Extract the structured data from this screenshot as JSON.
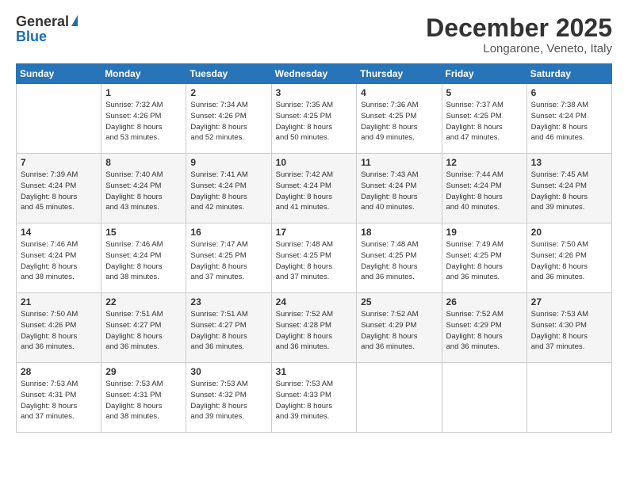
{
  "logo": {
    "general": "General",
    "blue": "Blue"
  },
  "title": {
    "month": "December 2025",
    "location": "Longarone, Veneto, Italy"
  },
  "headers": [
    "Sunday",
    "Monday",
    "Tuesday",
    "Wednesday",
    "Thursday",
    "Friday",
    "Saturday"
  ],
  "weeks": [
    [
      {
        "day": "",
        "info": ""
      },
      {
        "day": "1",
        "info": "Sunrise: 7:32 AM\nSunset: 4:26 PM\nDaylight: 8 hours\nand 53 minutes."
      },
      {
        "day": "2",
        "info": "Sunrise: 7:34 AM\nSunset: 4:26 PM\nDaylight: 8 hours\nand 52 minutes."
      },
      {
        "day": "3",
        "info": "Sunrise: 7:35 AM\nSunset: 4:25 PM\nDaylight: 8 hours\nand 50 minutes."
      },
      {
        "day": "4",
        "info": "Sunrise: 7:36 AM\nSunset: 4:25 PM\nDaylight: 8 hours\nand 49 minutes."
      },
      {
        "day": "5",
        "info": "Sunrise: 7:37 AM\nSunset: 4:25 PM\nDaylight: 8 hours\nand 47 minutes."
      },
      {
        "day": "6",
        "info": "Sunrise: 7:38 AM\nSunset: 4:24 PM\nDaylight: 8 hours\nand 46 minutes."
      }
    ],
    [
      {
        "day": "7",
        "info": "Sunrise: 7:39 AM\nSunset: 4:24 PM\nDaylight: 8 hours\nand 45 minutes."
      },
      {
        "day": "8",
        "info": "Sunrise: 7:40 AM\nSunset: 4:24 PM\nDaylight: 8 hours\nand 43 minutes."
      },
      {
        "day": "9",
        "info": "Sunrise: 7:41 AM\nSunset: 4:24 PM\nDaylight: 8 hours\nand 42 minutes."
      },
      {
        "day": "10",
        "info": "Sunrise: 7:42 AM\nSunset: 4:24 PM\nDaylight: 8 hours\nand 41 minutes."
      },
      {
        "day": "11",
        "info": "Sunrise: 7:43 AM\nSunset: 4:24 PM\nDaylight: 8 hours\nand 40 minutes."
      },
      {
        "day": "12",
        "info": "Sunrise: 7:44 AM\nSunset: 4:24 PM\nDaylight: 8 hours\nand 40 minutes."
      },
      {
        "day": "13",
        "info": "Sunrise: 7:45 AM\nSunset: 4:24 PM\nDaylight: 8 hours\nand 39 minutes."
      }
    ],
    [
      {
        "day": "14",
        "info": "Sunrise: 7:46 AM\nSunset: 4:24 PM\nDaylight: 8 hours\nand 38 minutes."
      },
      {
        "day": "15",
        "info": "Sunrise: 7:46 AM\nSunset: 4:24 PM\nDaylight: 8 hours\nand 38 minutes."
      },
      {
        "day": "16",
        "info": "Sunrise: 7:47 AM\nSunset: 4:25 PM\nDaylight: 8 hours\nand 37 minutes."
      },
      {
        "day": "17",
        "info": "Sunrise: 7:48 AM\nSunset: 4:25 PM\nDaylight: 8 hours\nand 37 minutes."
      },
      {
        "day": "18",
        "info": "Sunrise: 7:48 AM\nSunset: 4:25 PM\nDaylight: 8 hours\nand 36 minutes."
      },
      {
        "day": "19",
        "info": "Sunrise: 7:49 AM\nSunset: 4:25 PM\nDaylight: 8 hours\nand 36 minutes."
      },
      {
        "day": "20",
        "info": "Sunrise: 7:50 AM\nSunset: 4:26 PM\nDaylight: 8 hours\nand 36 minutes."
      }
    ],
    [
      {
        "day": "21",
        "info": "Sunrise: 7:50 AM\nSunset: 4:26 PM\nDaylight: 8 hours\nand 36 minutes."
      },
      {
        "day": "22",
        "info": "Sunrise: 7:51 AM\nSunset: 4:27 PM\nDaylight: 8 hours\nand 36 minutes."
      },
      {
        "day": "23",
        "info": "Sunrise: 7:51 AM\nSunset: 4:27 PM\nDaylight: 8 hours\nand 36 minutes."
      },
      {
        "day": "24",
        "info": "Sunrise: 7:52 AM\nSunset: 4:28 PM\nDaylight: 8 hours\nand 36 minutes."
      },
      {
        "day": "25",
        "info": "Sunrise: 7:52 AM\nSunset: 4:29 PM\nDaylight: 8 hours\nand 36 minutes."
      },
      {
        "day": "26",
        "info": "Sunrise: 7:52 AM\nSunset: 4:29 PM\nDaylight: 8 hours\nand 36 minutes."
      },
      {
        "day": "27",
        "info": "Sunrise: 7:53 AM\nSunset: 4:30 PM\nDaylight: 8 hours\nand 37 minutes."
      }
    ],
    [
      {
        "day": "28",
        "info": "Sunrise: 7:53 AM\nSunset: 4:31 PM\nDaylight: 8 hours\nand 37 minutes."
      },
      {
        "day": "29",
        "info": "Sunrise: 7:53 AM\nSunset: 4:31 PM\nDaylight: 8 hours\nand 38 minutes."
      },
      {
        "day": "30",
        "info": "Sunrise: 7:53 AM\nSunset: 4:32 PM\nDaylight: 8 hours\nand 39 minutes."
      },
      {
        "day": "31",
        "info": "Sunrise: 7:53 AM\nSunset: 4:33 PM\nDaylight: 8 hours\nand 39 minutes."
      },
      {
        "day": "",
        "info": ""
      },
      {
        "day": "",
        "info": ""
      },
      {
        "day": "",
        "info": ""
      }
    ]
  ]
}
